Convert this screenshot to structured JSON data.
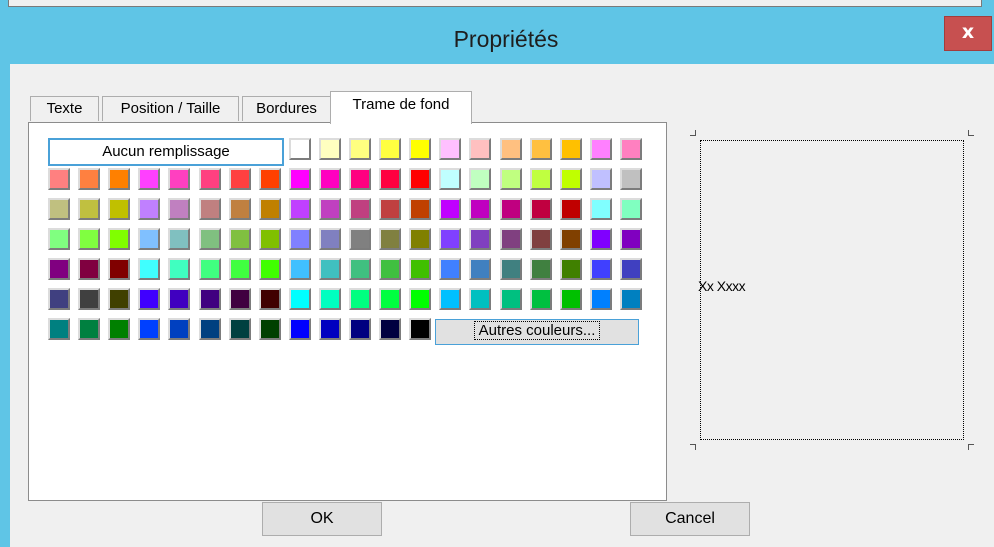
{
  "window": {
    "title": "Propriétés",
    "close_label": "x"
  },
  "tabs": [
    {
      "label": "Texte",
      "active": false
    },
    {
      "label": "Position / Taille",
      "active": false
    },
    {
      "label": "Bordures",
      "active": false
    },
    {
      "label": "Trame de fond",
      "active": true
    }
  ],
  "fill": {
    "none_label": "Aucun remplissage",
    "more_colors_label": "Autres couleurs...",
    "colors": [
      [
        "#ffffff",
        "#ffffc0",
        "#ffff80",
        "#ffff40",
        "#ffff00",
        "#ffc0ff",
        "#ffc0c0",
        "#ffc080",
        "#ffc040",
        "#ffc000",
        "#ff80ff",
        "#ff80c0"
      ],
      [
        "#ff8080",
        "#ff8040",
        "#ff8000",
        "#ff40ff",
        "#ff40c0",
        "#ff4080",
        "#ff4040",
        "#ff4000",
        "#ff00ff",
        "#ff00c0",
        "#ff0080",
        "#ff0040",
        "#ff0000",
        "#c0ffff",
        "#c0ffc0",
        "#c0ff80",
        "#c0ff40",
        "#c0ff00",
        "#c0c0ff",
        "#c0c0c0"
      ],
      [
        "#c0c080",
        "#c0c040",
        "#c0c000",
        "#c080ff",
        "#c080c0",
        "#c08080",
        "#c08040",
        "#c08000",
        "#c040ff",
        "#c040c0",
        "#c04080",
        "#c04040",
        "#c04000",
        "#c000ff",
        "#c000c0",
        "#c00080",
        "#c00040",
        "#c00000",
        "#80ffff",
        "#80ffc0"
      ],
      [
        "#80ff80",
        "#80ff40",
        "#80ff00",
        "#80c0ff",
        "#80c0c0",
        "#80c080",
        "#80c040",
        "#80c000",
        "#8080ff",
        "#8080c0",
        "#808080",
        "#808040",
        "#808000",
        "#8040ff",
        "#8040c0",
        "#804080",
        "#804040",
        "#804000",
        "#8000ff",
        "#8000c0"
      ],
      [
        "#800080",
        "#800040",
        "#800000",
        "#40ffff",
        "#40ffc0",
        "#40ff80",
        "#40ff40",
        "#40ff00",
        "#40c0ff",
        "#40c0c0",
        "#40c080",
        "#40c040",
        "#40c000",
        "#4080ff",
        "#4080c0",
        "#408080",
        "#408040",
        "#408000",
        "#4040ff",
        "#4040c0"
      ],
      [
        "#404080",
        "#404040",
        "#404000",
        "#4000ff",
        "#4000c0",
        "#400080",
        "#400040",
        "#400000",
        "#00ffff",
        "#00ffc0",
        "#00ff80",
        "#00ff40",
        "#00ff00",
        "#00c0ff",
        "#00c0c0",
        "#00c080",
        "#00c040",
        "#00c000",
        "#0080ff",
        "#0080c0"
      ],
      [
        "#008080",
        "#008040",
        "#008000",
        "#0040ff",
        "#0040c0",
        "#004080",
        "#004040",
        "#004000",
        "#0000ff",
        "#0000c0",
        "#000080",
        "#000040",
        "#000000"
      ]
    ]
  },
  "preview": {
    "sample_text": "Xx Xxxx"
  },
  "buttons": {
    "ok": "OK",
    "cancel": "Cancel"
  }
}
